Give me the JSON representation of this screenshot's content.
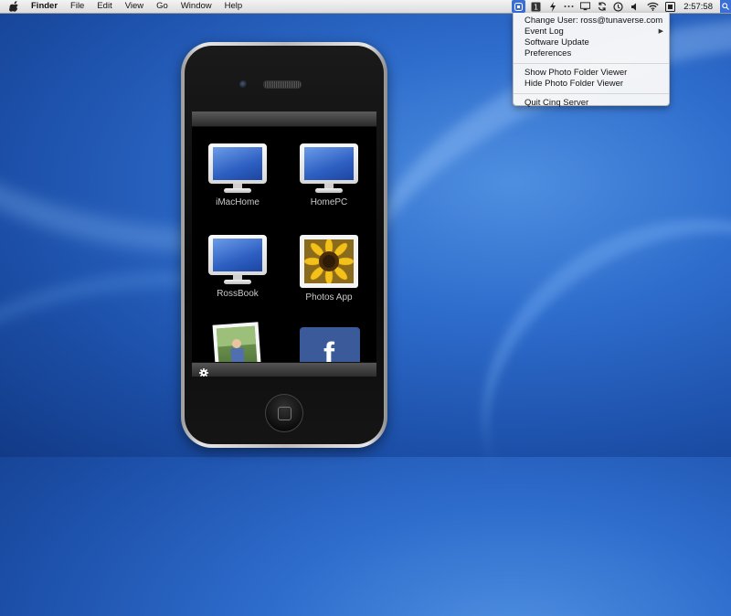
{
  "menubar": {
    "app": "Finder",
    "items": [
      "File",
      "Edit",
      "View",
      "Go",
      "Window",
      "Help"
    ],
    "status_icons": [
      "cinq-icon",
      "bluetooth-badge-icon",
      "tools-icon",
      "dots-icon",
      "display-icon",
      "sync-icon",
      "time-machine-icon",
      "volume-icon",
      "wifi-icon",
      "battery-icon"
    ],
    "clock": "2:57:58"
  },
  "dropdown": {
    "change_user": "Change User: ross@tunaverse.com",
    "event_log": "Event Log",
    "software_update": "Software Update",
    "preferences": "Preferences",
    "show_viewer": "Show Photo Folder Viewer",
    "hide_viewer": "Hide Photo Folder Viewer",
    "quit": "Quit Cinq Server"
  },
  "phone": {
    "tiles": [
      {
        "label": "iMacHome",
        "icon": "monitor-icon"
      },
      {
        "label": "HomePC",
        "icon": "monitor-icon"
      },
      {
        "label": "RossBook",
        "icon": "monitor-icon"
      },
      {
        "label": "Photos App",
        "icon": "sunflower-photo-icon"
      },
      {
        "label": "",
        "icon": "photo-snapshot-icon"
      },
      {
        "label": "",
        "icon": "facebook-icon"
      }
    ],
    "facebook_glyph": "f"
  },
  "colors": {
    "desktop_blue": "#2e6ccc",
    "menu_highlight": "#3a6fd6",
    "facebook_blue": "#3b5a9a"
  }
}
